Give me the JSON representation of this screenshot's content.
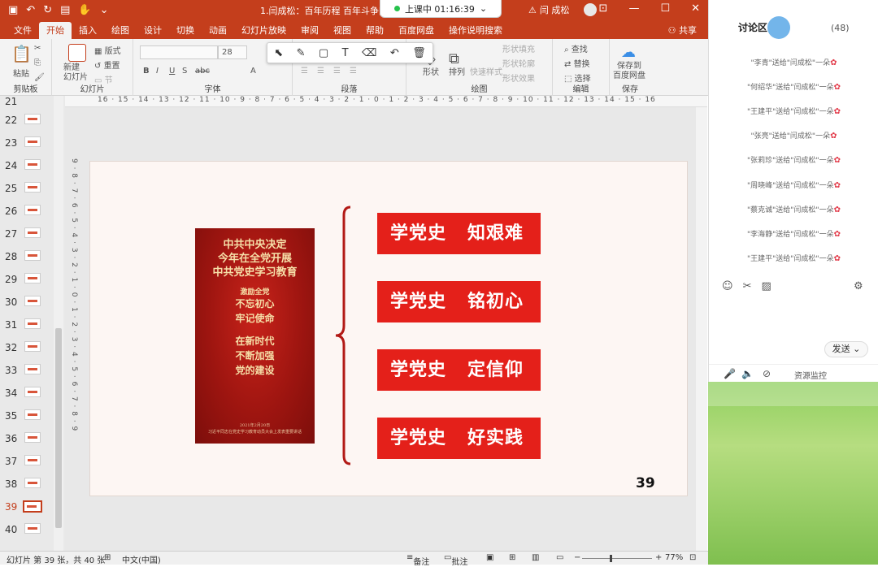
{
  "app": {
    "doc_title": "1.闫成松：百年历程 百年斗争[兼容",
    "user_name": "闫 成松",
    "share_label": "共享"
  },
  "timer": {
    "label": "上课中 01:16:39"
  },
  "tabs": [
    "文件",
    "开始",
    "插入",
    "绘图",
    "设计",
    "切换",
    "动画",
    "幻灯片放映",
    "审阅",
    "视图",
    "帮助",
    "百度网盘",
    "操作说明搜索"
  ],
  "active_tab": "开始",
  "ribbon": {
    "groups": [
      {
        "label": "剪贴板"
      },
      {
        "label": "幻灯片"
      },
      {
        "label": "字体"
      },
      {
        "label": "段落"
      },
      {
        "label": "绘图"
      },
      {
        "label": "编辑"
      },
      {
        "label": "保存"
      }
    ],
    "paste": "粘贴",
    "new_slide": "新建\n幻灯片",
    "layout": "版式",
    "reset": "重置",
    "section": "节",
    "font_size": "28",
    "shape": "形状",
    "arrange": "排列",
    "quick_style": "快速样式",
    "shape_fill": "形状填充",
    "shape_outline": "形状轮廓",
    "shape_effect": "形状效果",
    "find": "查找",
    "replace": "替换",
    "select": "选择",
    "save_baidu": "保存到\n百度网盘"
  },
  "thumbnails": [
    "21",
    "22",
    "23",
    "24",
    "25",
    "26",
    "27",
    "28",
    "29",
    "30",
    "31",
    "32",
    "33",
    "34",
    "35",
    "36",
    "37",
    "38",
    "39",
    "40"
  ],
  "active_slide": "39",
  "slide": {
    "poster_heading": [
      "中共中央决定",
      "今年在全党开展",
      "中共党史学习教育"
    ],
    "poster_sub": "激励全党",
    "poster_mid1": [
      "不忘初心",
      "牢记使命"
    ],
    "poster_mid2": [
      "在新时代",
      "不断加强",
      "党的建设"
    ],
    "poster_footer": [
      "2021年2月20日",
      "习近平同志在党史学习教育动员大会上发表重要讲话"
    ],
    "items": [
      "学党史   知艰难",
      "学党史   铭初心",
      "学党史   定信仰",
      "学党史   好实践"
    ],
    "page_number": "39"
  },
  "ruler_text": "16 · 15 · 14 · 13 · 12 · 11 · 10 · 9 · 8 · 7 · 6 · 5 · 4 · 3 · 2 · 1 · 0 · 1 · 2 · 3 · 4 · 5 · 6 · 7 · 8 · 9 · 10 · 11 · 12 · 13 · 14 · 15 · 16",
  "vruler_text": "9 · 8 · 7 · 6 · 5 · 4 · 3 · 2 · 1 · 0 · 1 · 2 · 3 · 4 · 5 · 6 · 7 · 8 · 9",
  "status": {
    "slide_info": "幻灯片 第 39 张，共 40 张",
    "language": "中文(中国)",
    "notes": "备注",
    "comments": "批注",
    "zoom": "77%"
  },
  "chat": {
    "title": "讨论区",
    "count": "(48)",
    "messages": [
      "\"李青\"送给\"闫成松\"一朵",
      "\"何绍华\"送给\"闫成松\"一朵",
      "\"王建平\"送给\"闫成松\"一朵",
      "\"张亮\"送给\"闫成松\"一朵",
      "\"张莉珍\"送给\"闫成松\"一朵",
      "\"周晓峰\"送给\"闫成松\"一朵",
      "\"蔡克诚\"送给\"闫成松\"一朵",
      "\"李海静\"送给\"闫成松\"一朵",
      "\"王建平\"送给\"闫成松\"一朵"
    ],
    "send_label": "发送",
    "monitor_label": "资源监控"
  }
}
